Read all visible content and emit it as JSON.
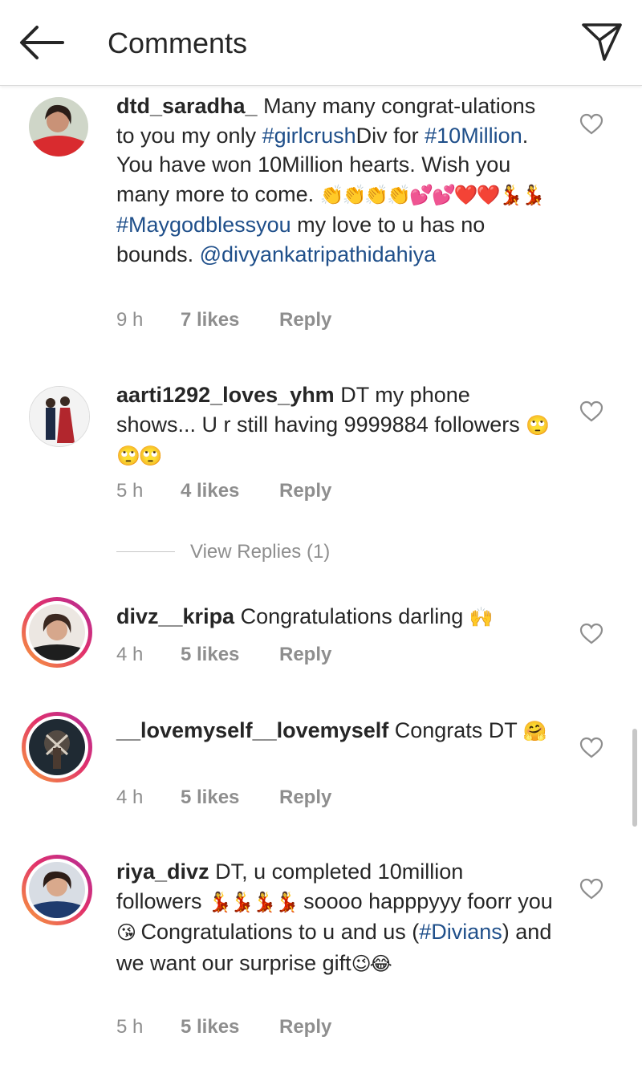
{
  "header": {
    "title": "Comments",
    "back_icon": "back-arrow-icon",
    "send_icon": "send-icon"
  },
  "comments": [
    {
      "username": "dtd_saradha_",
      "segments": [
        {
          "t": " Many many congrat-"
        },
        {
          "t": "ulations to you my only "
        },
        {
          "t": "#girlcrush",
          "link": true
        },
        {
          "t": "Div for "
        },
        {
          "t": "#10Million",
          "link": true
        },
        {
          "t": ". You have won 10Million hearts. Wish you many more to come. "
        },
        {
          "t": "👏👏👏👏💕💕❤️❤️💃💃",
          "emoji": true
        },
        {
          "t": " "
        },
        {
          "t": "#Maygodblessyou",
          "link": true
        },
        {
          "t": " my love to u has no bounds. "
        },
        {
          "t": "@divyankatripathidahiya",
          "link": true
        }
      ],
      "time": "9 h",
      "likes": "7 likes",
      "reply": "Reply"
    },
    {
      "username": "aarti1292_loves_yhm",
      "segments": [
        {
          "t": " DT my phone shows... U r still having 9999884 followers "
        },
        {
          "t": "🙄🙄🙄",
          "emoji": true
        }
      ],
      "time": "5 h",
      "likes": "4 likes",
      "reply": "Reply"
    },
    {
      "username": "divz__kripa",
      "segments": [
        {
          "t": " Congratulations darling "
        },
        {
          "t": "🙌",
          "emoji": true
        }
      ],
      "time": "4 h",
      "likes": "5 likes",
      "reply": "Reply"
    },
    {
      "username": "__lovemyself__lovemyself",
      "segments": [
        {
          "t": " Congrats DT "
        },
        {
          "t": "🤗",
          "emoji": true
        }
      ],
      "time": "4 h",
      "likes": "5 likes",
      "reply": "Reply"
    },
    {
      "username": "riya_divz",
      "segments": [
        {
          "t": " DT, u completed 10million followers "
        },
        {
          "t": "💃💃💃💃",
          "emoji": true
        },
        {
          "t": " soooo happpyyy foorr you"
        },
        {
          "t": "😘",
          "emoji": true
        },
        {
          "t": " Congratulations to u and us ("
        },
        {
          "t": "#Divians",
          "link": true
        },
        {
          "t": ") and we want our surprise gift"
        },
        {
          "t": "😉😂",
          "emoji": true
        }
      ],
      "time": "5 h",
      "likes": "5 likes",
      "reply": "Reply"
    }
  ],
  "view_replies": "View Replies (1)",
  "colors": {
    "text": "#262626",
    "muted": "#8e8e8e",
    "hashtag": "#1f4f8a",
    "story_ring_start": "#f9a13a",
    "story_ring_end": "#b12d9a"
  }
}
